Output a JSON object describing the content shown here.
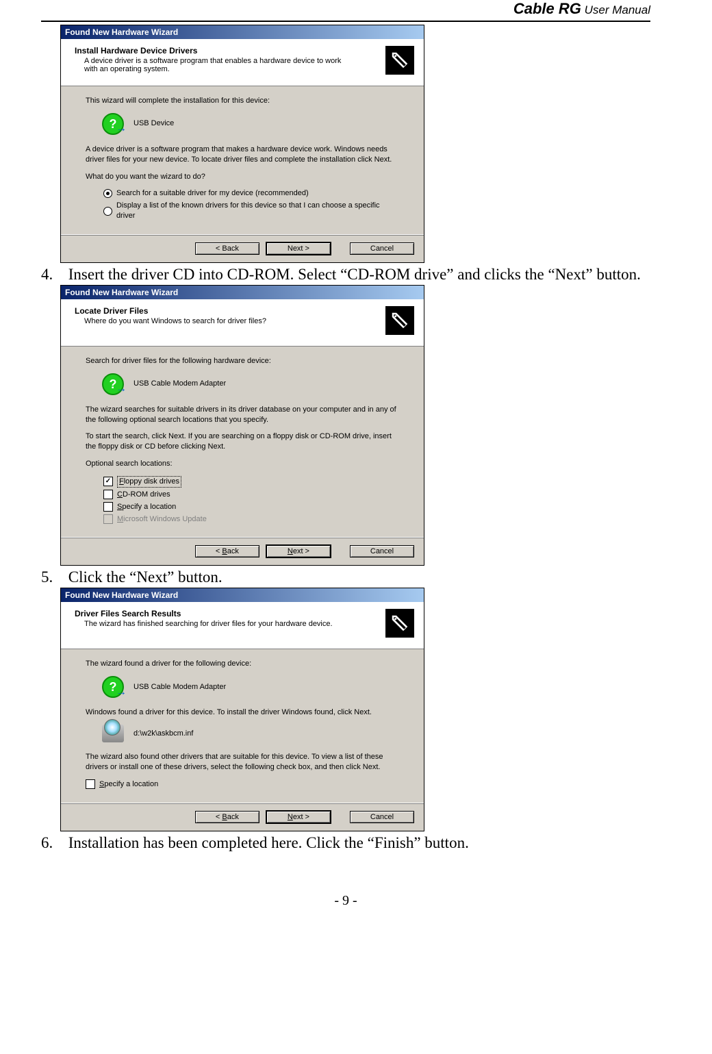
{
  "header": {
    "brand": "Cable RG",
    "subtitle": " User Manual"
  },
  "footer": {
    "page_number": "- 9 -"
  },
  "steps": {
    "s4": {
      "num": "4.",
      "text": "Insert the driver CD into CD-ROM. Select “CD-ROM drive” and clicks the “Next” button."
    },
    "s5": {
      "num": "5.",
      "text": "Click the “Next” button."
    },
    "s6": {
      "num": "6.",
      "text": "Installation has been completed here. Click the “Finish” button."
    }
  },
  "wizard1": {
    "title": "Found New Hardware Wizard",
    "heading": "Install Hardware Device Drivers",
    "subheading": "A device driver is a software program that enables a hardware device to work with an operating system.",
    "line_intro": "This wizard will complete the installation for this device:",
    "device": "USB Device",
    "explain": "A device driver is a software program that makes a hardware device work. Windows needs driver files for your new device. To locate driver files and complete the installation click Next.",
    "prompt": "What do you want the wizard to do?",
    "opt1": "Search for a suitable driver for my device (recommended)",
    "opt2": "Display a list of the known drivers for this device so that I can choose a specific driver",
    "btn_back": "< Back",
    "btn_next": "Next >",
    "btn_cancel": "Cancel"
  },
  "wizard2": {
    "title": "Found New Hardware Wizard",
    "heading": "Locate Driver Files",
    "subheading": "Where do you want Windows to search for driver files?",
    "line_intro": "Search for driver files for the following hardware device:",
    "device": "USB Cable Modem Adapter",
    "explain1": "The wizard searches for suitable drivers in its driver database on your computer and in any of the following optional search locations that you specify.",
    "explain2": "To start the search, click Next. If you are searching on a floppy disk or CD-ROM drive, insert the floppy disk or CD before clicking Next.",
    "opt_label": "Optional search locations:",
    "chk1": "Floppy disk drives",
    "chk2": "CD-ROM drives",
    "chk3": "Specify a location",
    "chk4": "Microsoft Windows Update",
    "btn_back": "< Back",
    "btn_next": "Next >",
    "btn_cancel": "Cancel"
  },
  "wizard3": {
    "title": "Found New Hardware Wizard",
    "heading": "Driver Files Search Results",
    "subheading": "The wizard has finished searching for driver files for your hardware device.",
    "line_intro": "The wizard found a driver for the following device:",
    "device": "USB Cable Modem Adapter",
    "explain1": "Windows found a driver for this device. To install the driver Windows found, click Next.",
    "driver_path": "d:\\w2k\\askbcm.inf",
    "explain2": "The wizard also found other drivers that are suitable for this device. To view a list of these drivers or install one of these drivers, select the following check box, and then click Next.",
    "chk1": "Specify a location",
    "btn_back": "< Back",
    "btn_next": "Next >",
    "btn_cancel": "Cancel"
  }
}
